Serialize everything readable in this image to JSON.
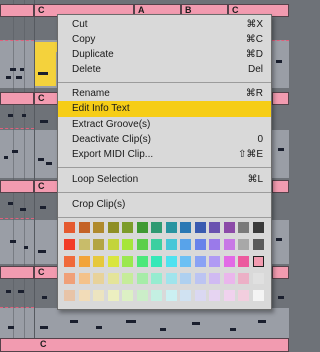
{
  "clip_letters": {
    "top_row": [
      "C",
      "A",
      "A",
      "B",
      "C"
    ],
    "mid_row_1": [
      "C"
    ],
    "mid_row_2": [
      "C"
    ],
    "mid_row_3": [
      "C"
    ],
    "mid_row_4": [
      "C"
    ]
  },
  "menu": {
    "groups": [
      [
        {
          "label": "Cut",
          "shortcut": "⌘X"
        },
        {
          "label": "Copy",
          "shortcut": "⌘C"
        },
        {
          "label": "Duplicate",
          "shortcut": "⌘D"
        },
        {
          "label": "Delete",
          "shortcut": "Del"
        }
      ],
      [
        {
          "label": "Rename",
          "shortcut": "⌘R"
        },
        {
          "label": "Edit Info Text",
          "shortcut": "",
          "highlighted": true
        },
        {
          "label": "Extract Groove(s)",
          "shortcut": ""
        },
        {
          "label": "Deactivate Clip(s)",
          "shortcut": "0"
        },
        {
          "label": "Export MIDI Clip...",
          "shortcut": "⇧⌘E"
        }
      ],
      [
        {
          "label": "Loop Selection",
          "shortcut": "⌘L"
        }
      ],
      [
        {
          "label": "Crop Clip(s)",
          "shortcut": ""
        }
      ]
    ],
    "highlight_color": "#f6cd16"
  },
  "color_palette": {
    "rows": [
      [
        "#e55a2f",
        "#c46226",
        "#b08a2c",
        "#8f8f24",
        "#7c9c2a",
        "#3f9a32",
        "#2f9a72",
        "#2894a0",
        "#2a78b4",
        "#3a5ab0",
        "#6a52b0",
        "#8c4aa8",
        "#7a7a7a",
        "#3a3a3a"
      ],
      [
        "#f23c28",
        "#c8bc6a",
        "#b3a544",
        "#c3d43a",
        "#a6e63a",
        "#5ccf4a",
        "#3ccfa0",
        "#46c7d8",
        "#58a3ea",
        "#6882ea",
        "#9a7aea",
        "#c878e6",
        "#a8a8a8",
        "#5a5a5a"
      ],
      [
        "#f06a3a",
        "#f2a43a",
        "#e6c83c",
        "#d9e63e",
        "#9be84e",
        "#4ce87a",
        "#36e8b8",
        "#4ee2f0",
        "#6cc0f4",
        "#8aa2f4",
        "#b09af4",
        "#e26ae6",
        "#ec5a9e",
        "#f29bb0"
      ],
      [
        "#f0a078",
        "#f4c28a",
        "#e8d29a",
        "#e4e49a",
        "#c6ec9a",
        "#a6eca8",
        "#96ecd0",
        "#a0e4ec",
        "#aed0f0",
        "#bcc4f2",
        "#d0baf2",
        "#eab6ec",
        "#ecb0c6",
        "#e0e0e0"
      ],
      [
        "#e8c4a8",
        "#f2dcb8",
        "#ece4c0",
        "#ecefc0",
        "#dcf0c4",
        "#cbeec8",
        "#c4f0e2",
        "#cbf0f2",
        "#d0e2f2",
        "#dad8f2",
        "#e6d4f2",
        "#f0d2ee",
        "#f2cede",
        "#f4f4f4"
      ]
    ],
    "selected": [
      2,
      13
    ]
  }
}
